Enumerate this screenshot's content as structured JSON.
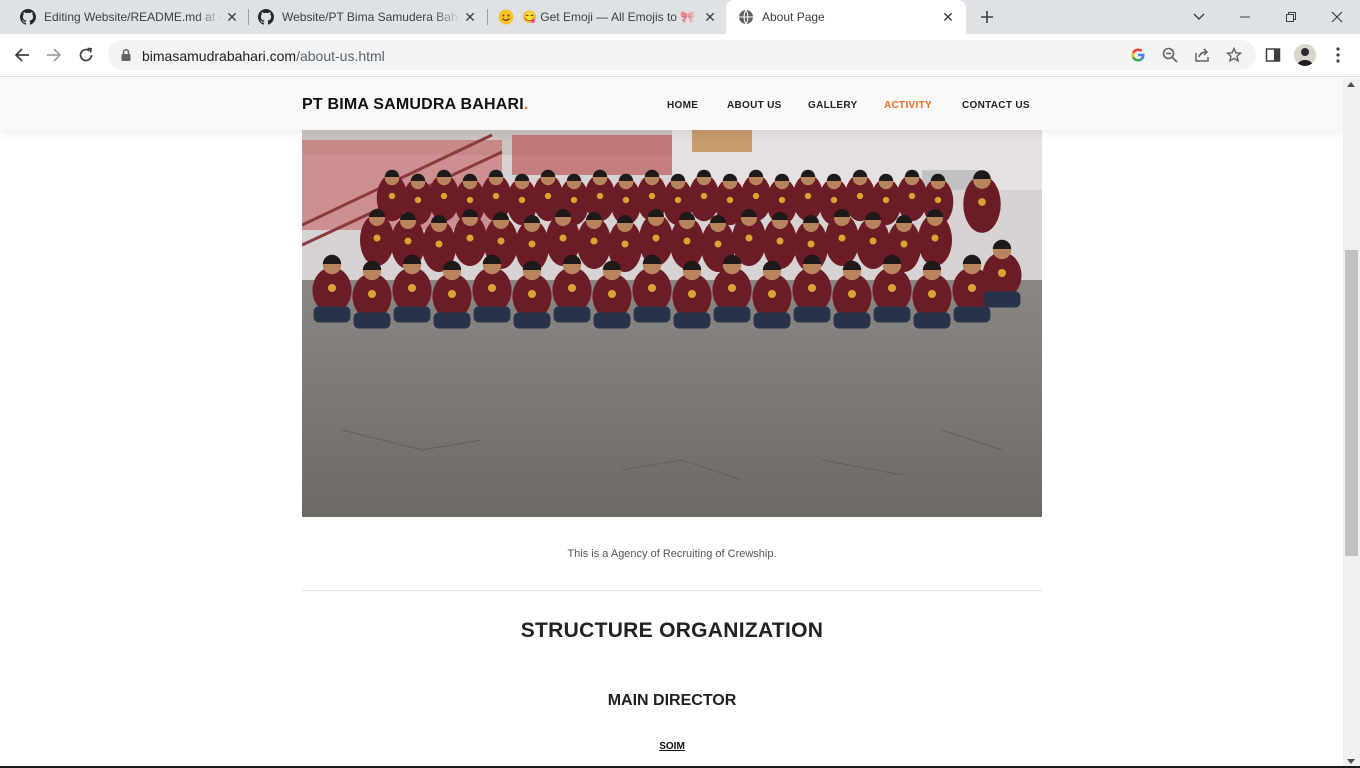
{
  "browser": {
    "tabs": [
      {
        "title": "Editing Website/README.md at main",
        "icon": "github-icon",
        "active": false
      },
      {
        "title": "Website/PT Bima Samudera Bahari",
        "icon": "github-icon",
        "active": false
      },
      {
        "title": "😋 Get Emoji — All Emojis to 🎀",
        "icon": "emoji-icon",
        "active": false
      },
      {
        "title": "About Page",
        "icon": "globe-icon",
        "active": true
      }
    ],
    "url_host": "bimasamudrabahari.com",
    "url_path": "/about-us.html"
  },
  "site": {
    "logo_text": "PT BIMA SAMUDRA BAHARI",
    "logo_dot": ".",
    "nav": [
      {
        "label": "HOME"
      },
      {
        "label": "ABOUT US"
      },
      {
        "label": "GALLERY"
      },
      {
        "label": "ACTIVITY"
      },
      {
        "label": "CONTACT US"
      }
    ],
    "active_nav": "ACTIVITY",
    "accent_color": "#e96b1f",
    "hoodie_color": "#6b1c24"
  },
  "content": {
    "caption": "This is a Agency of Recruiting of Crewship.",
    "section_title": "STRUCTURE ORGANIZATION",
    "role_title": "MAIN DIRECTOR",
    "director_name": "SOIM"
  }
}
